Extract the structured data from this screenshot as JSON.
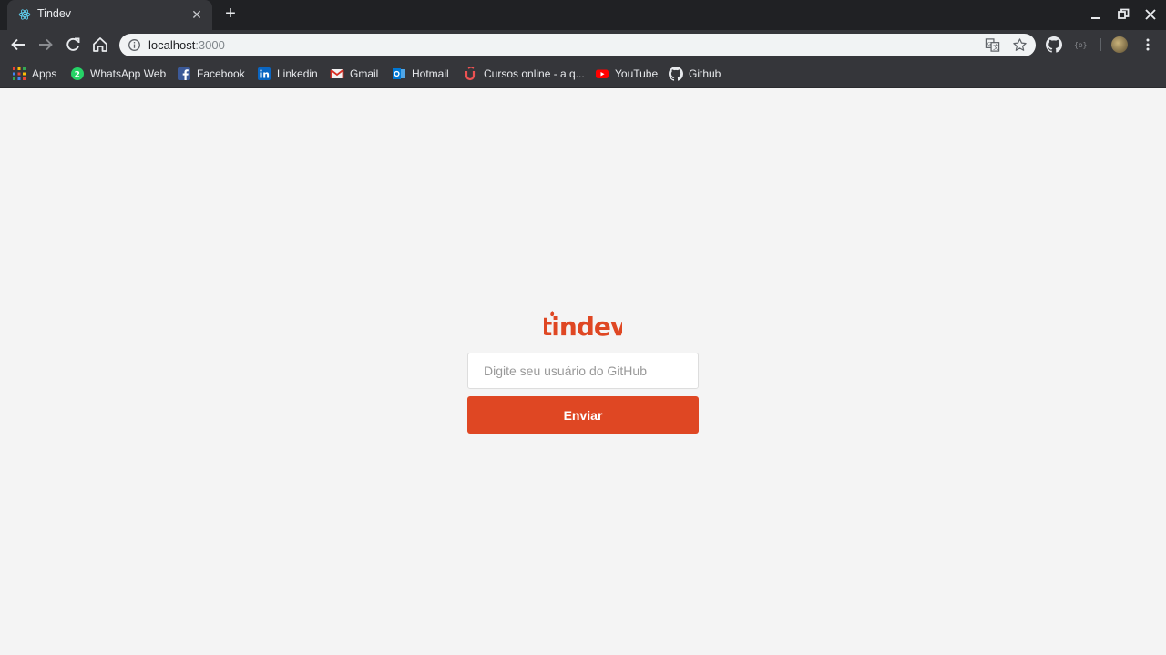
{
  "browser": {
    "tab": {
      "title": "Tindev",
      "favicon": "react-icon"
    },
    "url_host": "localhost",
    "url_port": ":3000",
    "bookmarks": [
      {
        "label": "Apps",
        "icon": "apps-grid-icon"
      },
      {
        "label": "WhatsApp Web",
        "icon": "whatsapp-icon"
      },
      {
        "label": "Facebook",
        "icon": "facebook-icon"
      },
      {
        "label": "Linkedin",
        "icon": "linkedin-icon"
      },
      {
        "label": "Gmail",
        "icon": "gmail-icon"
      },
      {
        "label": "Hotmail",
        "icon": "outlook-icon"
      },
      {
        "label": "Cursos online - a q...",
        "icon": "udemy-icon"
      },
      {
        "label": "YouTube",
        "icon": "youtube-icon"
      },
      {
        "label": "Github",
        "icon": "github-icon"
      }
    ]
  },
  "login": {
    "logo": "tindev",
    "username_placeholder": "Digite seu usuário do GitHub",
    "username_value": "",
    "submit_label": "Enviar"
  },
  "colors": {
    "brand": "#df4723",
    "page_background": "#f4f4f4",
    "chrome_dark": "#202124",
    "chrome_toolbar": "#35363a"
  }
}
